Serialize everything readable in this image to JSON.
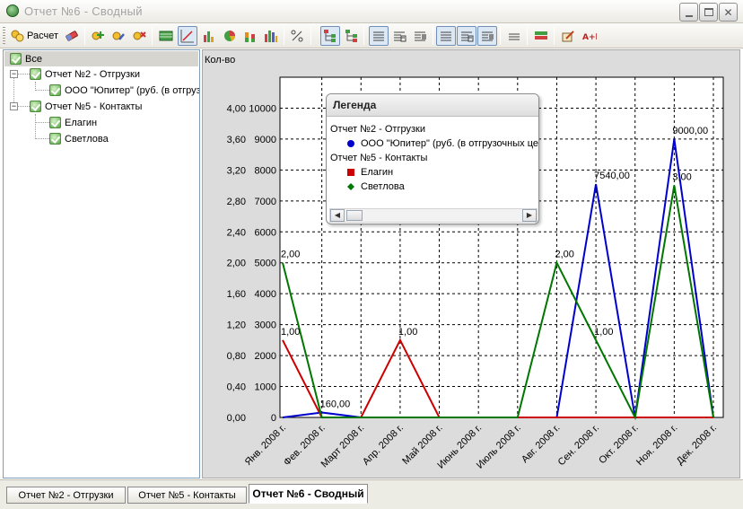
{
  "window": {
    "title": "Отчет №6 - Сводный",
    "controls": [
      "minimize",
      "maximize",
      "close"
    ]
  },
  "toolbar": {
    "calc_label": "Расчет",
    "buttons": [
      "calculate-icon",
      "eraser-icon",
      "add-report-icon",
      "edit-report-icon",
      "remove-report-icon",
      "table-view-icon",
      "line-chart-icon",
      "bar-chart-icon",
      "pie-chart-icon",
      "stacked-chart-icon",
      "histogram-icon",
      "percent-icon",
      "tree-expand-icon",
      "tree-collapse-icon",
      "align-left-icon",
      "align-center-icon",
      "align-right-icon",
      "rows-icon",
      "rows-center-icon",
      "rows-right-icon",
      "lines-icon",
      "color-grid-icon",
      "edit-icon",
      "text-ab-icon"
    ]
  },
  "tree": {
    "root": "Все",
    "nodes": [
      {
        "label": "Отчет №2 - Отгрузки",
        "children": [
          "ООО \"Юпитер\" (руб. (в отгрузочных ценах))"
        ]
      },
      {
        "label": "Отчет №5 - Контакты",
        "children": [
          "Елагин",
          "Светлова"
        ]
      }
    ]
  },
  "chart_data": {
    "type": "line",
    "ylabel": "Кол-во",
    "categories": [
      "Янв. 2008 г.",
      "Фев. 2008 г.",
      "Март 2008 г.",
      "Апр. 2008 г.",
      "Май 2008 г.",
      "Июнь 2008 г.",
      "Июль 2008 г.",
      "Авг. 2008 г.",
      "Сен. 2008 г.",
      "Окт. 2008 г.",
      "Ноя. 2008 г.",
      "Дек. 2008 г."
    ],
    "y_left_ticks": [
      "0,00",
      "0,40",
      "0,80",
      "1,20",
      "1,60",
      "2,00",
      "2,40",
      "2,80",
      "3,20",
      "3,60",
      "4,00"
    ],
    "y_right_ticks": [
      "0",
      "1000",
      "2000",
      "3000",
      "4000",
      "5000",
      "6000",
      "7000",
      "8000",
      "9000",
      "10000"
    ],
    "ylim_left": [
      0,
      4.4
    ],
    "ylim_right": [
      0,
      11000
    ],
    "grid": true,
    "series": [
      {
        "name": "ООО \"Юпитер\" (руб. (в отгрузочных ценах))",
        "axis": "right",
        "color": "#0000cc",
        "values": [
          0,
          160,
          0,
          0,
          0,
          0,
          0,
          0,
          7540,
          0,
          9000,
          0
        ],
        "labels": [
          "",
          "160,00",
          "",
          "",
          "",
          "",
          "",
          "",
          "7540,00",
          "",
          "9000,00",
          ""
        ]
      },
      {
        "name": "Елагин",
        "axis": "left",
        "color": "#cc0000",
        "values": [
          1,
          0,
          0,
          1,
          0,
          0,
          0,
          0,
          0,
          0,
          0,
          0
        ],
        "labels": [
          "1,00",
          "",
          "",
          "1,00",
          "",
          "",
          "",
          "",
          "",
          "",
          "",
          ""
        ]
      },
      {
        "name": "Светлова",
        "axis": "left",
        "color": "#007700",
        "values": [
          2,
          0,
          0,
          0,
          0,
          0,
          0,
          2,
          1,
          0,
          3,
          0
        ],
        "labels": [
          "2,00",
          "",
          "",
          "",
          "",
          "",
          "",
          "2,00",
          "1,00",
          "",
          "3,00",
          ""
        ]
      }
    ]
  },
  "legend": {
    "title": "Легенда",
    "groups": [
      {
        "label": "Отчет №2 - Отгрузки",
        "items": [
          {
            "label": "ООО \"Юпитер\" (руб. (в отгрузочных ценах))",
            "color": "#0000cc",
            "shape": "circle"
          }
        ]
      },
      {
        "label": "Отчет №5 - Контакты",
        "items": [
          {
            "label": "Елагин",
            "color": "#cc0000",
            "shape": "square"
          },
          {
            "label": "Светлова",
            "color": "#007700",
            "shape": "diamond"
          }
        ]
      }
    ]
  },
  "tabs": [
    {
      "label": "Отчет №2 - Отгрузки",
      "active": false
    },
    {
      "label": "Отчет №5 - Контакты",
      "active": false
    },
    {
      "label": "Отчет №6 - Сводный",
      "active": true
    }
  ]
}
